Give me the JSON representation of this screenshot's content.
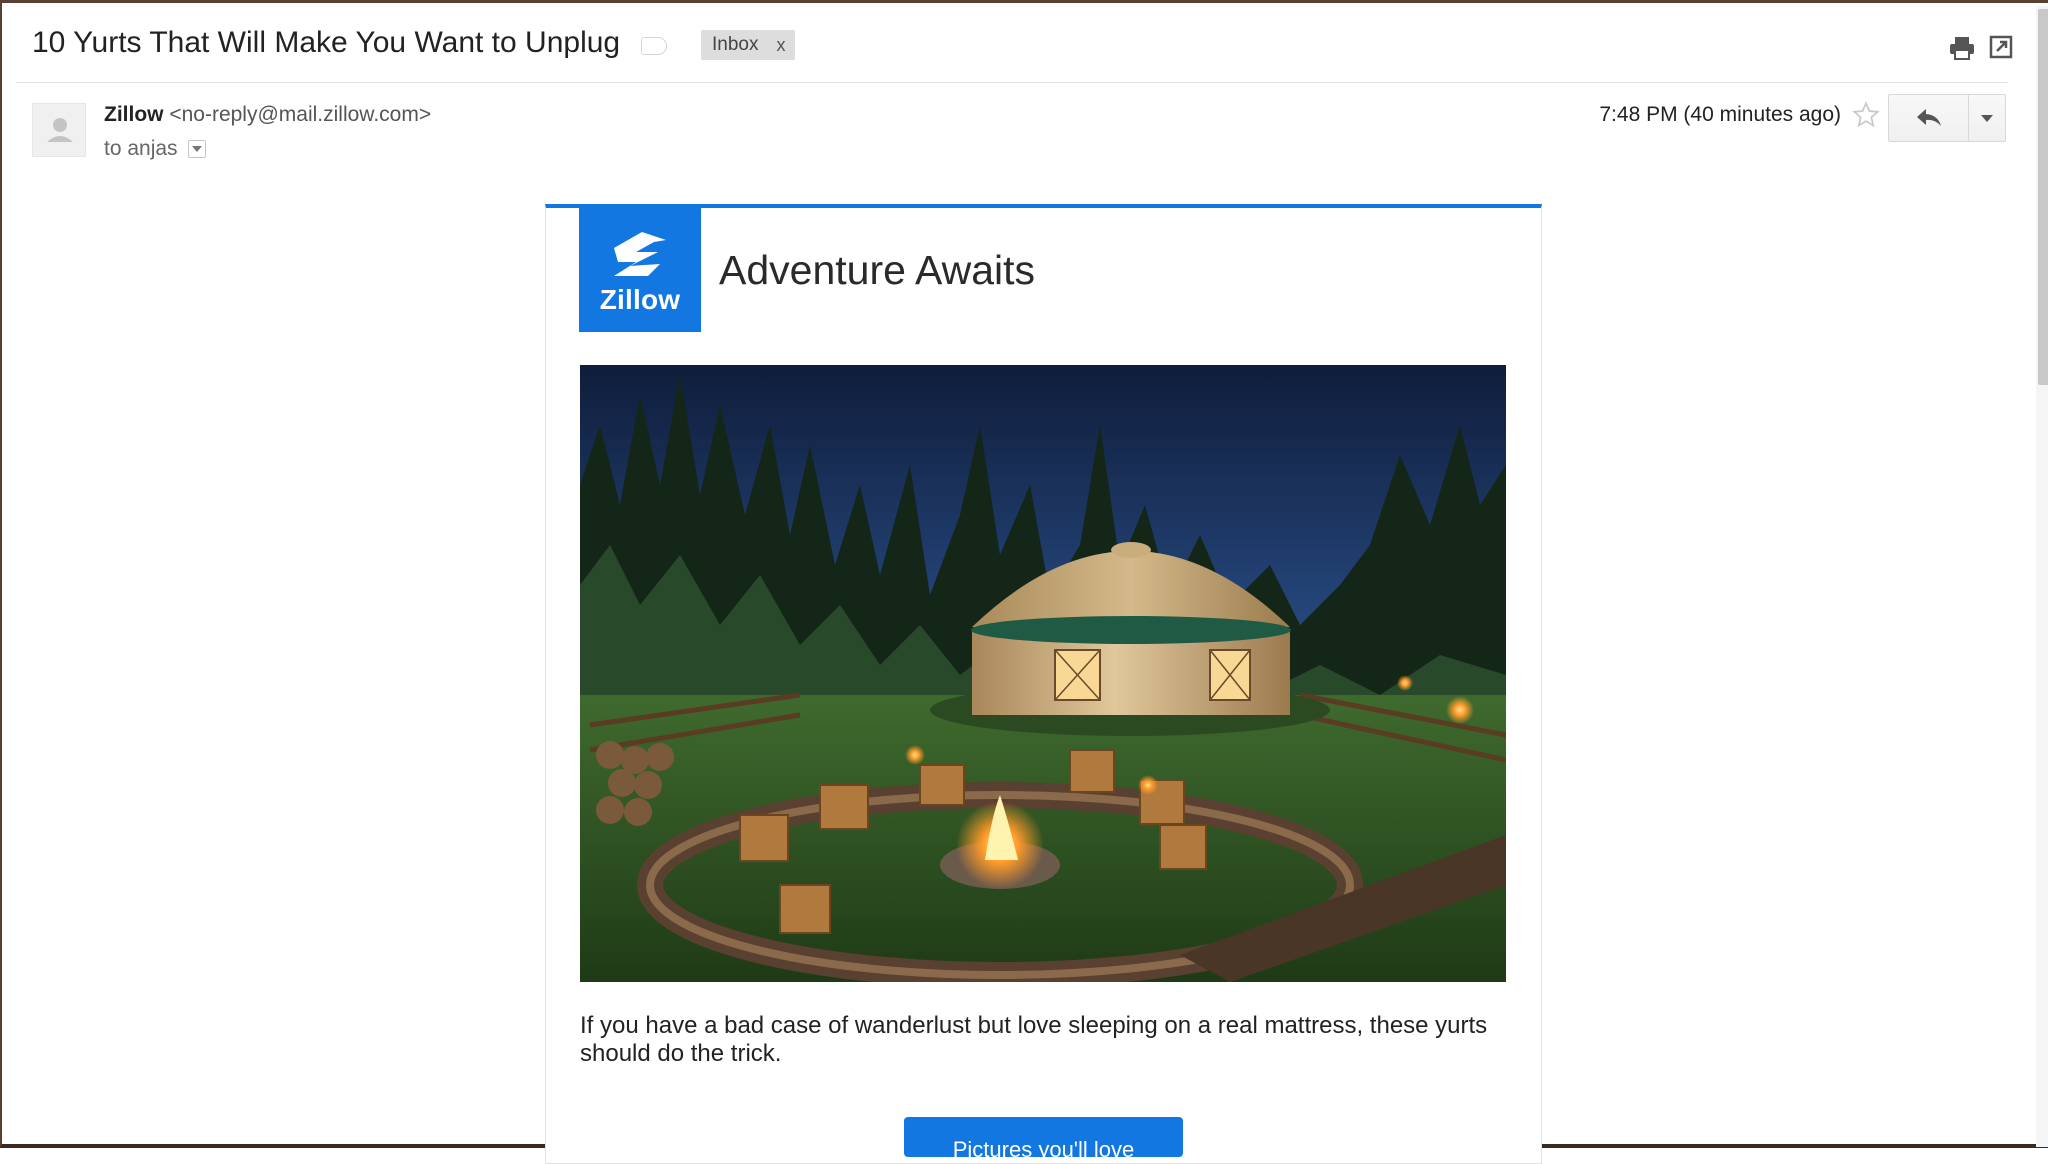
{
  "subject": "10 Yurts That Will Make You Want to Unplug",
  "label": {
    "name": "Inbox",
    "remove": "x"
  },
  "sender": {
    "name": "Zillow",
    "email": "<no-reply@mail.zillow.com>"
  },
  "recipient": {
    "to": "to anjas"
  },
  "timestamp": "7:48 PM (40 minutes ago)",
  "icons": {
    "print": "print-icon",
    "new_window": "new-window-icon",
    "star": "star-icon",
    "reply": "reply-icon",
    "more": "chevron-down-icon",
    "avatar": "person-icon"
  },
  "email": {
    "logo_text": "Zillow",
    "headline": "Adventure Awaits",
    "image_subject": "yurt at night",
    "body": "If you have a bad case of wanderlust but love sleeping on a real mattress, these yurts should do the trick.",
    "cta": "Pictures you'll love"
  },
  "colors": {
    "brand_blue": "#1277e1"
  }
}
